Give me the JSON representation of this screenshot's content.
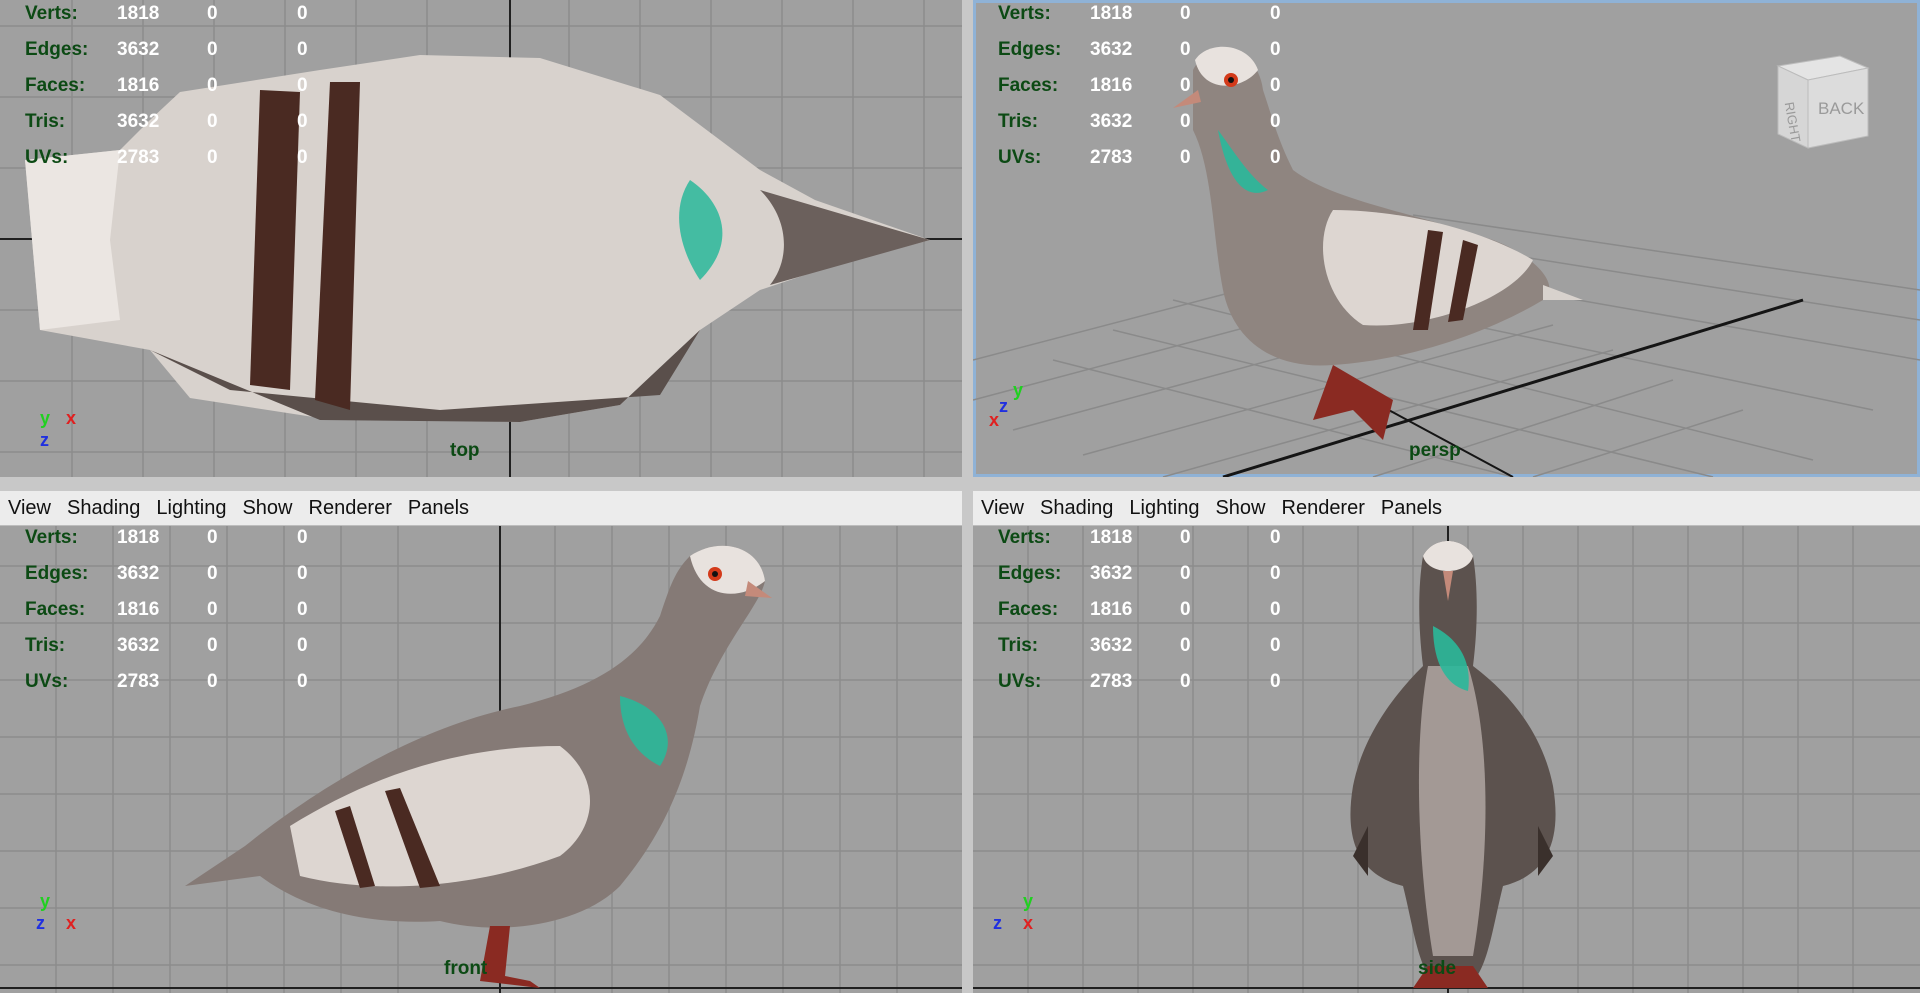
{
  "hud_labels": {
    "verts": "Verts:",
    "edges": "Edges:",
    "faces": "Faces:",
    "tris": "Tris:",
    "uvs": "UVs:"
  },
  "hud_values": {
    "verts": [
      "1818",
      "0",
      "0"
    ],
    "edges": [
      "3632",
      "0",
      "0"
    ],
    "faces": [
      "1816",
      "0",
      "0"
    ],
    "tris": [
      "3632",
      "0",
      "0"
    ],
    "uvs": [
      "2783",
      "0",
      "0"
    ]
  },
  "menu": {
    "view": "View",
    "shading": "Shading",
    "lighting": "Lighting",
    "show": "Show",
    "renderer": "Renderer",
    "panels": "Panels"
  },
  "viewports": {
    "top": {
      "camera": "top"
    },
    "persp": {
      "camera": "persp"
    },
    "front": {
      "camera": "front"
    },
    "side": {
      "camera": "side"
    }
  },
  "viewcube": {
    "face_right": "RIGHT",
    "face_back": "BACK"
  },
  "axes": {
    "x": "x",
    "y": "y",
    "z": "z"
  },
  "colors": {
    "viewport_bg": "#a0a0a0",
    "grid": "#8c8c8c",
    "hud_label": "#0c4a14",
    "hud_value": "#ffffff",
    "active_border": "#8fb2d6",
    "axis_x": "#e02020",
    "axis_y": "#20d020",
    "axis_z": "#2030e0"
  },
  "icons": {
    "viewcube": "viewcube-icon",
    "axis_gizmo": "axis-gizmo-icon",
    "pigeon_model": "pigeon-model"
  }
}
